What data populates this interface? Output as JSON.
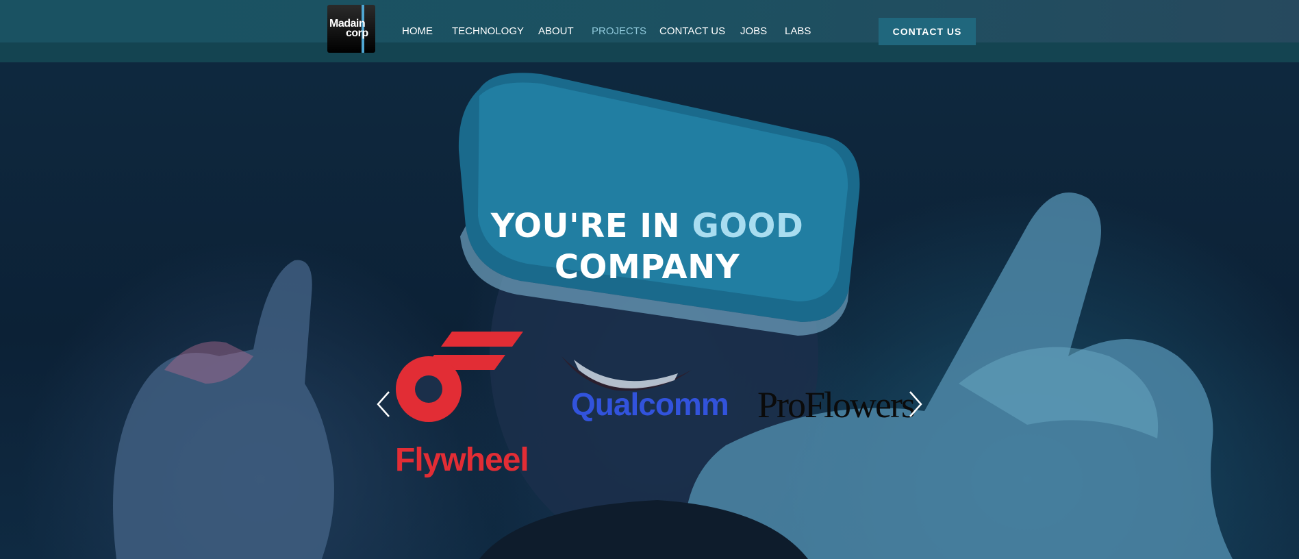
{
  "brand": {
    "logo_line1": "Madain",
    "logo_line2": "corp"
  },
  "nav": {
    "items": [
      {
        "label": "HOME",
        "active": false
      },
      {
        "label": "TECHNOLOGY",
        "active": false
      },
      {
        "label": "ABOUT",
        "active": false
      },
      {
        "label": "PROJECTS",
        "active": true
      },
      {
        "label": "CONTACT US",
        "active": false
      },
      {
        "label": "JOBS",
        "active": false
      },
      {
        "label": "LABS",
        "active": false
      }
    ],
    "cta_label": "CONTACT US"
  },
  "hero": {
    "headline_part1": "YOU'RE IN",
    "headline_accent": "GOOD",
    "headline_part2": "COMPANY"
  },
  "carousel": {
    "prev_icon": "chevron-left-icon",
    "next_icon": "chevron-right-icon",
    "logos": [
      {
        "name": "Flywheel",
        "color": "#e22d35"
      },
      {
        "name": "Qualcomm",
        "color": "#3253dc"
      },
      {
        "name": "ProFlowers",
        "color": "#0b0b0b"
      }
    ]
  },
  "colors": {
    "header_bg": "#1d5364",
    "cta_bg": "#20677d",
    "active_nav": "#8ec7d9",
    "accent": "#a9ddf0"
  }
}
